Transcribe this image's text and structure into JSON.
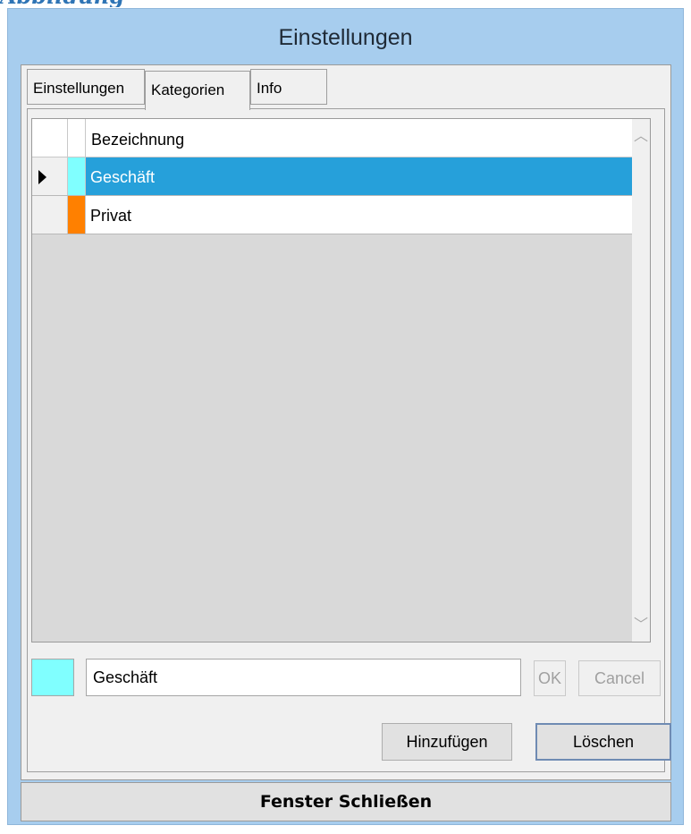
{
  "caption_fragment": "Abbildung",
  "window": {
    "title": "Einstellungen"
  },
  "tabs": [
    {
      "label": "Einstellungen",
      "active": false
    },
    {
      "label": "Kategorien",
      "active": true
    },
    {
      "label": "Info",
      "active": false
    }
  ],
  "grid": {
    "columns": [
      {
        "label": ""
      },
      {
        "label": ""
      },
      {
        "label": "Bezeichnung"
      }
    ],
    "rows": [
      {
        "name": "Geschäft",
        "color": "#80ffff",
        "selected": true
      },
      {
        "name": "Privat",
        "color": "#ff8000",
        "selected": false
      }
    ],
    "scroll_up_icon": "chevron-up-icon",
    "scroll_down_icon": "chevron-down-icon",
    "scroll_up_glyph": "︿",
    "scroll_down_glyph": "﹀"
  },
  "editor": {
    "swatch_color": "#80ffff",
    "name_value": "Geschäft",
    "ok_label": "OK",
    "cancel_label": "Cancel"
  },
  "buttons": {
    "add_label": "Hinzufügen",
    "delete_label": "Löschen",
    "close_label": "Fenster Schließen"
  },
  "colors": {
    "titlebar": "#a7cdee",
    "selection": "#26a0da"
  }
}
